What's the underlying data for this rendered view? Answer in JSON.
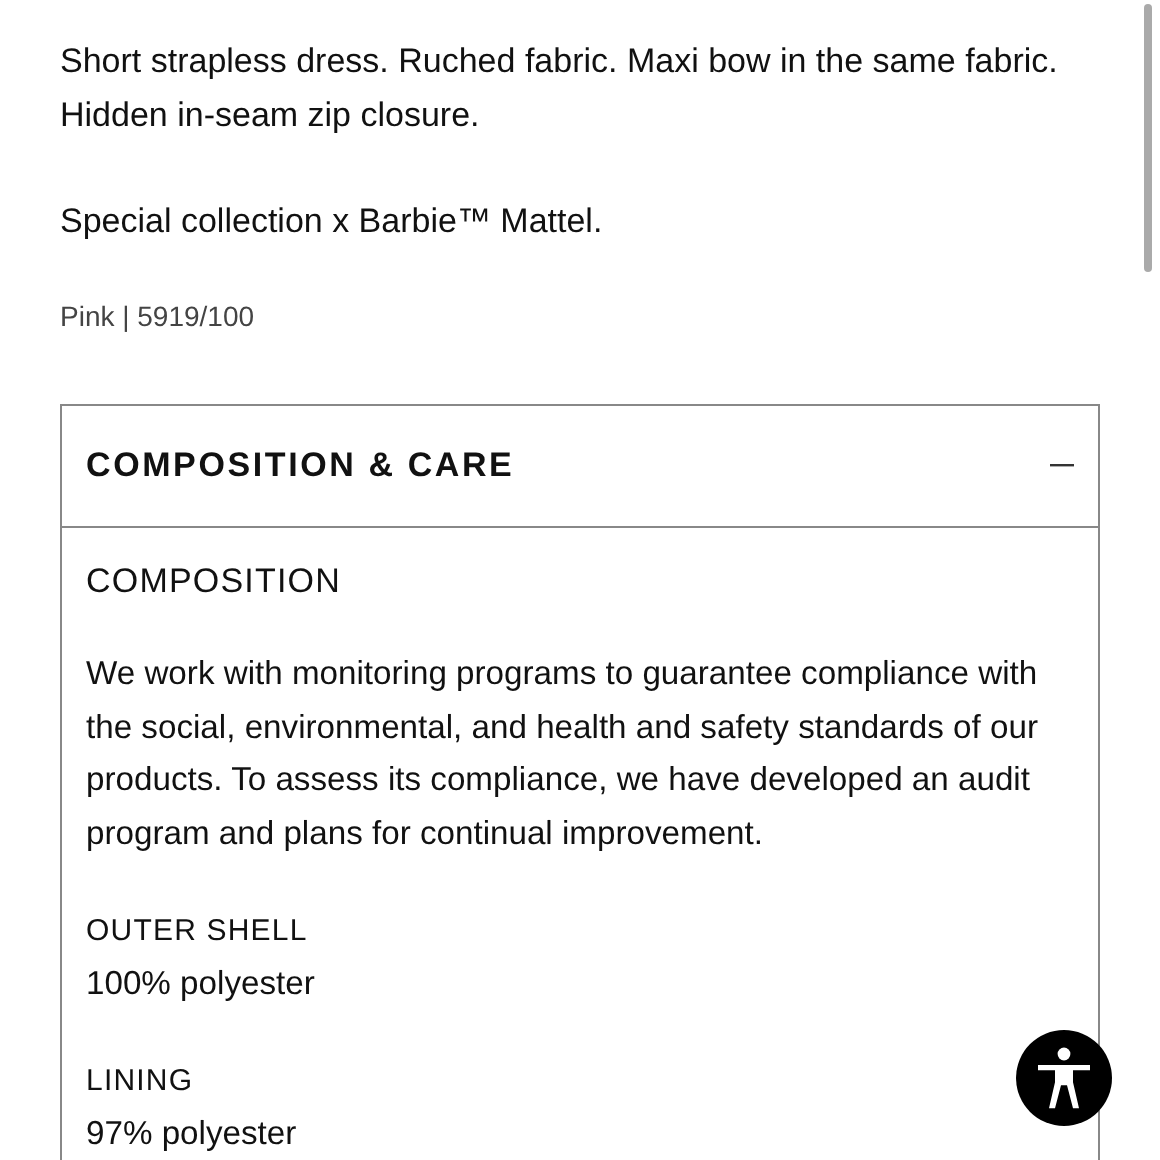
{
  "description": [
    "Short strapless dress. Ruched fabric. Maxi bow in the same fabric. Hidden in-seam zip closure.",
    "Special collection x Barbie™ Mattel."
  ],
  "color_ref": "Pink | 5919/100",
  "accordion": {
    "title": "COMPOSITION & CARE",
    "expanded": true,
    "section_title": "COMPOSITION",
    "text": "We work with monitoring programs to guarantee compliance with the social, environmental, and health and safety standards of our products. To assess its compliance, we have developed an audit program and plans for continual improvement.",
    "parts": [
      {
        "label": "OUTER SHELL",
        "value": "100% polyester"
      },
      {
        "label": "LINING",
        "value": "97% polyester"
      }
    ]
  }
}
